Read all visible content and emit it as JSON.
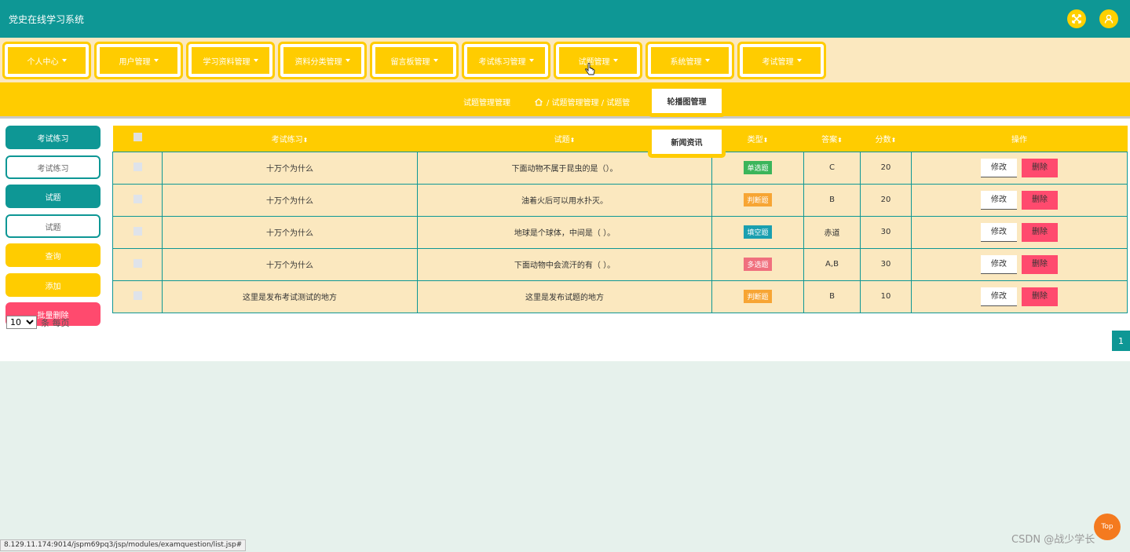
{
  "app": {
    "title": "党史在线学习系统"
  },
  "nav": {
    "items": [
      {
        "label": "个人中心"
      },
      {
        "label": "用户管理"
      },
      {
        "label": "学习资料管理"
      },
      {
        "label": "资料分类管理"
      },
      {
        "label": "留言板管理"
      },
      {
        "label": "考试练习管理"
      },
      {
        "label": "试题管理"
      },
      {
        "label": "系统管理"
      },
      {
        "label": "考试管理"
      }
    ]
  },
  "breadcrumb": {
    "title": "试题管理管理",
    "path": "/ 试题管理管理 / 试题管"
  },
  "popups": {
    "carousel": "轮播图管理",
    "news": "新闻资讯"
  },
  "sidebar": {
    "exam_practice_label": "考试练习",
    "exam_practice_input": "考试练习",
    "question_label": "试题",
    "question_input": "试题",
    "search": "查询",
    "add": "添加",
    "batch_delete": "批量删除"
  },
  "pager": {
    "per_page": "10",
    "suffix": "条 每页",
    "current_page": "1"
  },
  "table": {
    "headers": {
      "exam": "考试练习",
      "question": "试题",
      "type": "类型",
      "answer": "答案",
      "score": "分数",
      "actions": "操作"
    },
    "edit_label": "修改",
    "delete_label": "删除",
    "rows": [
      {
        "exam": "十万个为什么",
        "question": "下面动物不属于昆虫的是（）。",
        "type": "单选题",
        "type_color": "#3bb55a",
        "answer": "C",
        "score": "20"
      },
      {
        "exam": "十万个为什么",
        "question": "油着火后可以用水扑灭。",
        "type": "判断题",
        "type_color": "#f7a534",
        "answer": "B",
        "score": "20"
      },
      {
        "exam": "十万个为什么",
        "question": "地球是个球体，中间是（ ）。",
        "type": "填空题",
        "type_color": "#1a9fb0",
        "answer": "赤道",
        "score": "30"
      },
      {
        "exam": "十万个为什么",
        "question": "下面动物中会流汗的有（ ）。",
        "type": "多选题",
        "type_color": "#f0707e",
        "answer": "A,B",
        "score": "30"
      },
      {
        "exam": "这里是发布考试测试的地方",
        "question": "这里是发布试题的地方",
        "type": "判断题",
        "type_color": "#f7a534",
        "answer": "B",
        "score": "10"
      }
    ]
  },
  "status_url": "8.129.11.174:9014/jspm69pq3/jsp/modules/examquestion/list.jsp#",
  "watermark": "CSDN @战少学长",
  "top_button": "Top",
  "colors": {
    "teal": "#0e9795",
    "yellow": "#ffcc00",
    "cream": "#fbe8bf",
    "red": "#ff4a6e"
  }
}
